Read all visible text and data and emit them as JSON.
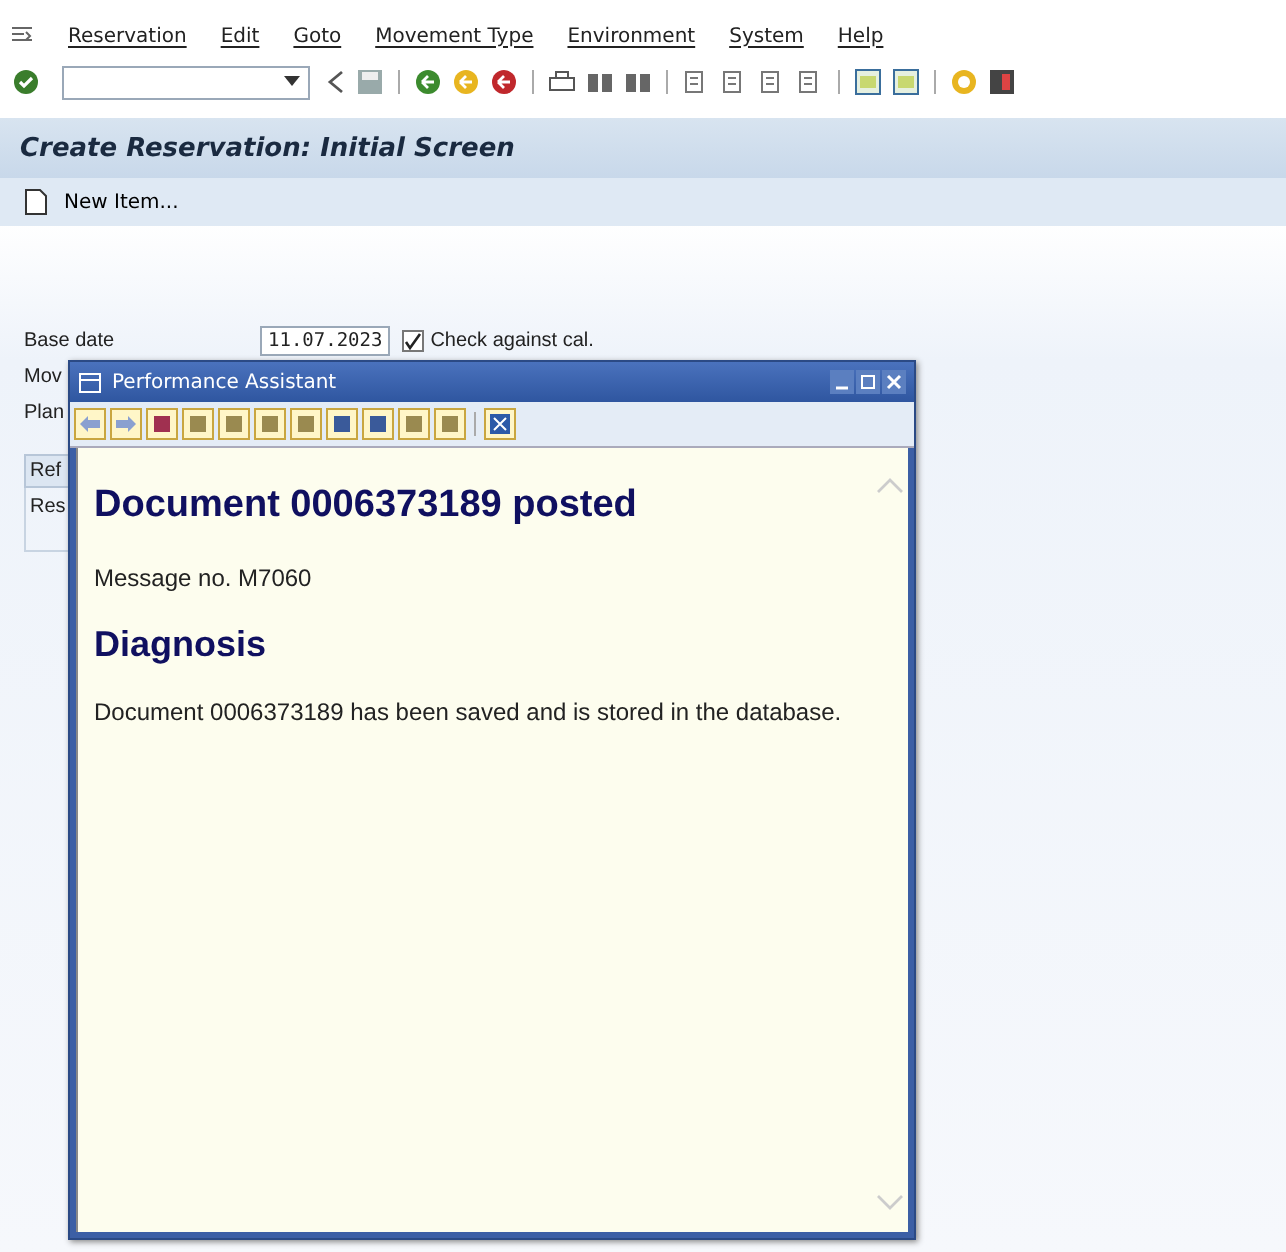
{
  "menu_bar": {
    "items": [
      "Reservation",
      "Edit",
      "Goto",
      "Movement Type",
      "Environment",
      "System",
      "Help"
    ]
  },
  "title": "Create Reservation: Initial Screen",
  "app_toolbar": {
    "items": [
      {
        "label": "New Item..."
      }
    ]
  },
  "form": {
    "base_date": {
      "label": "Base date",
      "value": "11.07.2023",
      "checkbox": {
        "label": "Check against cal.",
        "checked": true
      }
    },
    "partial_labels": [
      "Mov",
      "Plan"
    ]
  },
  "tabs": [
    {
      "label": "Ref",
      "selected": true
    }
  ],
  "tab_content": {
    "label": "Res"
  },
  "popup": {
    "title": "Performance Assistant",
    "heading": "Document 0006373189 posted",
    "message_no": "Message no. M7060",
    "section_title": "Diagnosis",
    "text": "Document 0006373189 has been saved and is stored in the database."
  }
}
